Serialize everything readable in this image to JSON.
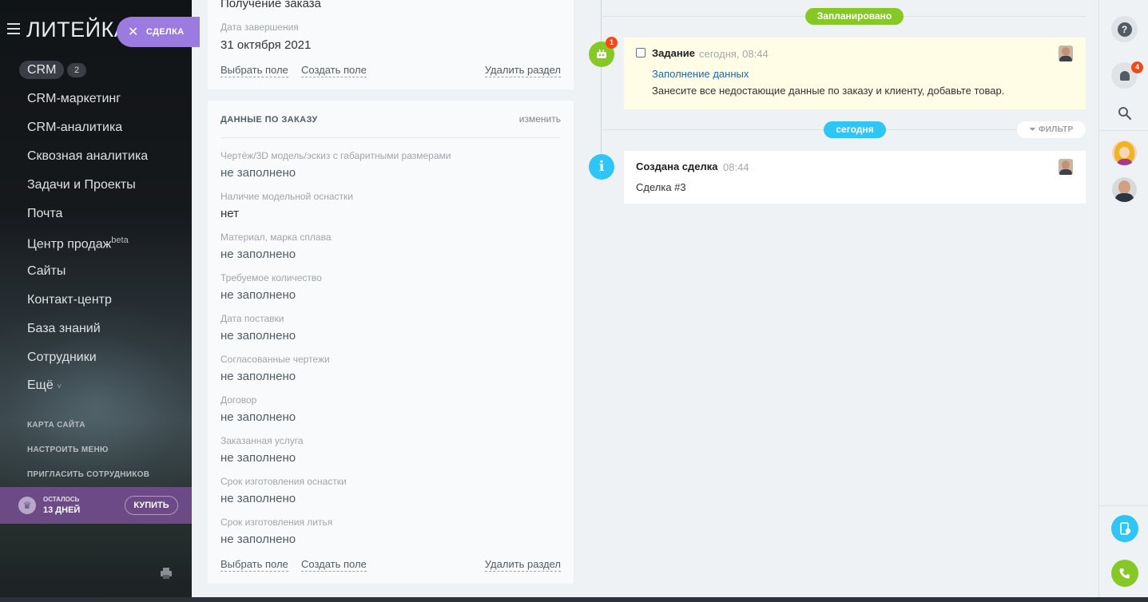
{
  "sidebar": {
    "logo": "ЛИТЕЙКА",
    "deal_pill": "СДЕЛКА",
    "crm": {
      "label": "CRM",
      "count": "2"
    },
    "items": [
      "CRM-маркетинг",
      "CRM-аналитика",
      "Сквозная аналитика",
      "Задачи и Проекты",
      "Почта",
      "Центр продаж",
      "Сайты",
      "Контакт-центр",
      "База знаний",
      "Сотрудники",
      "Ещё"
    ],
    "beta": "beta",
    "more_arrow": "˅",
    "small_links": [
      "КАРТА САЙТА",
      "НАСТРОИТЬ МЕНЮ",
      "ПРИГЛАСИТЬ СОТРУДНИКОВ"
    ],
    "trial": {
      "left1": "ОСТАЛОСЬ",
      "left2": "13 ДНЕЙ",
      "buy": "КУПИТЬ"
    }
  },
  "card1": {
    "top_value": "Получение заказа",
    "label": "Дата завершения",
    "value": "31 октября 2021",
    "choose_field": "Выбрать поле",
    "create_field": "Создать поле",
    "delete_section": "Удалить раздел"
  },
  "card2": {
    "title": "ДАННЫЕ ПО ЗАКАЗУ",
    "edit": "изменить",
    "fields": [
      {
        "label": "Чертёж/3D модель/эскиз с габаритными размерами",
        "value": "не заполнено"
      },
      {
        "label": "Наличие модельной оснастки",
        "value": "нет"
      },
      {
        "label": "Материал, марка сплава",
        "value": "не заполнено"
      },
      {
        "label": "Требуемое количество",
        "value": "не заполнено"
      },
      {
        "label": "Дата поставки",
        "value": "не заполнено"
      },
      {
        "label": "Согласованные чертежи",
        "value": "не заполнено"
      },
      {
        "label": "Договор",
        "value": "не заполнено"
      },
      {
        "label": "Заказанная услуга",
        "value": "не заполнено"
      },
      {
        "label": "Срок изготовления оснастки",
        "value": "не заполнено"
      },
      {
        "label": "Срок изготовления литья",
        "value": "не заполнено"
      }
    ],
    "choose_field": "Выбрать поле",
    "create_field": "Создать поле",
    "delete_section": "Удалить раздел"
  },
  "timeline": {
    "planned": "Запланировано",
    "today": "сегодня",
    "filter": "ФИЛЬТР",
    "task": {
      "badge": "1",
      "title": "Задание",
      "time": "сегодня, 08:44",
      "link": "Заполнение данных",
      "desc": "Занесите все недостающие данные по заказу и клиенту, добавьте товар."
    },
    "created": {
      "title": "Создана сделка",
      "time": "08:44",
      "subtitle": "Сделка #3"
    }
  },
  "right_sidebar": {
    "help": "?",
    "notifications_count": "4"
  },
  "colors": {
    "green": "#86c926",
    "blue": "#2fc6f6",
    "purple": "#9c7be0",
    "red_badge": "#f54819"
  }
}
